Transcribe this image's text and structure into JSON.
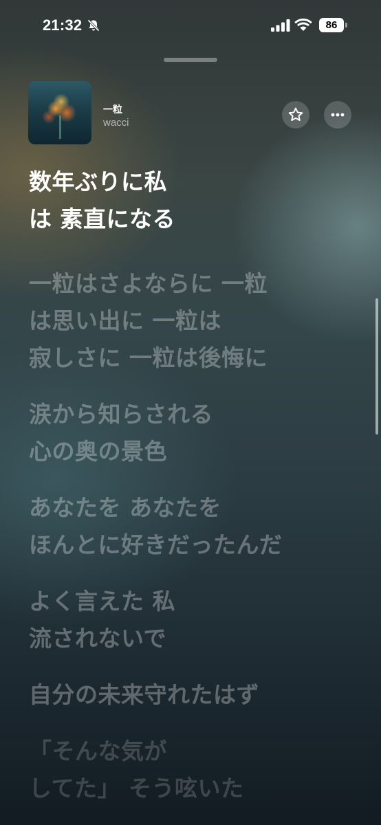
{
  "status_bar": {
    "time": "21:32",
    "battery": "86"
  },
  "now_playing": {
    "title": "一粒",
    "artist": "wacci",
    "artwork_icon": "album-artwork",
    "favorite_icon": "star-icon",
    "more_icon": "ellipsis-icon"
  },
  "lyrics": [
    {
      "lines": [
        "数年ぶりに私",
        "は 素直になる"
      ],
      "state": "current"
    },
    {
      "lines": [
        "一粒はさよならに 一粒",
        "は思い出に 一粒は",
        "寂しさに 一粒は後悔に"
      ],
      "state": "upcoming"
    },
    {
      "lines": [
        "涙から知らされる",
        "心の奥の景色"
      ],
      "state": "upcoming"
    },
    {
      "lines": [
        "あなたを あなたを",
        "ほんとに好きだったんだ"
      ],
      "state": "upcoming"
    },
    {
      "lines": [
        "よく言えた 私",
        "流されないで"
      ],
      "state": "upcoming"
    },
    {
      "lines": [
        "自分の未来守れたはず"
      ],
      "state": "upcoming"
    },
    {
      "lines": [
        "「そんな気が",
        "してた」 そう呟いた"
      ],
      "state": "faded"
    }
  ],
  "colors": {
    "text_active": "#ffffff",
    "text_inactive": "rgba(255,255,255,0.3)"
  }
}
